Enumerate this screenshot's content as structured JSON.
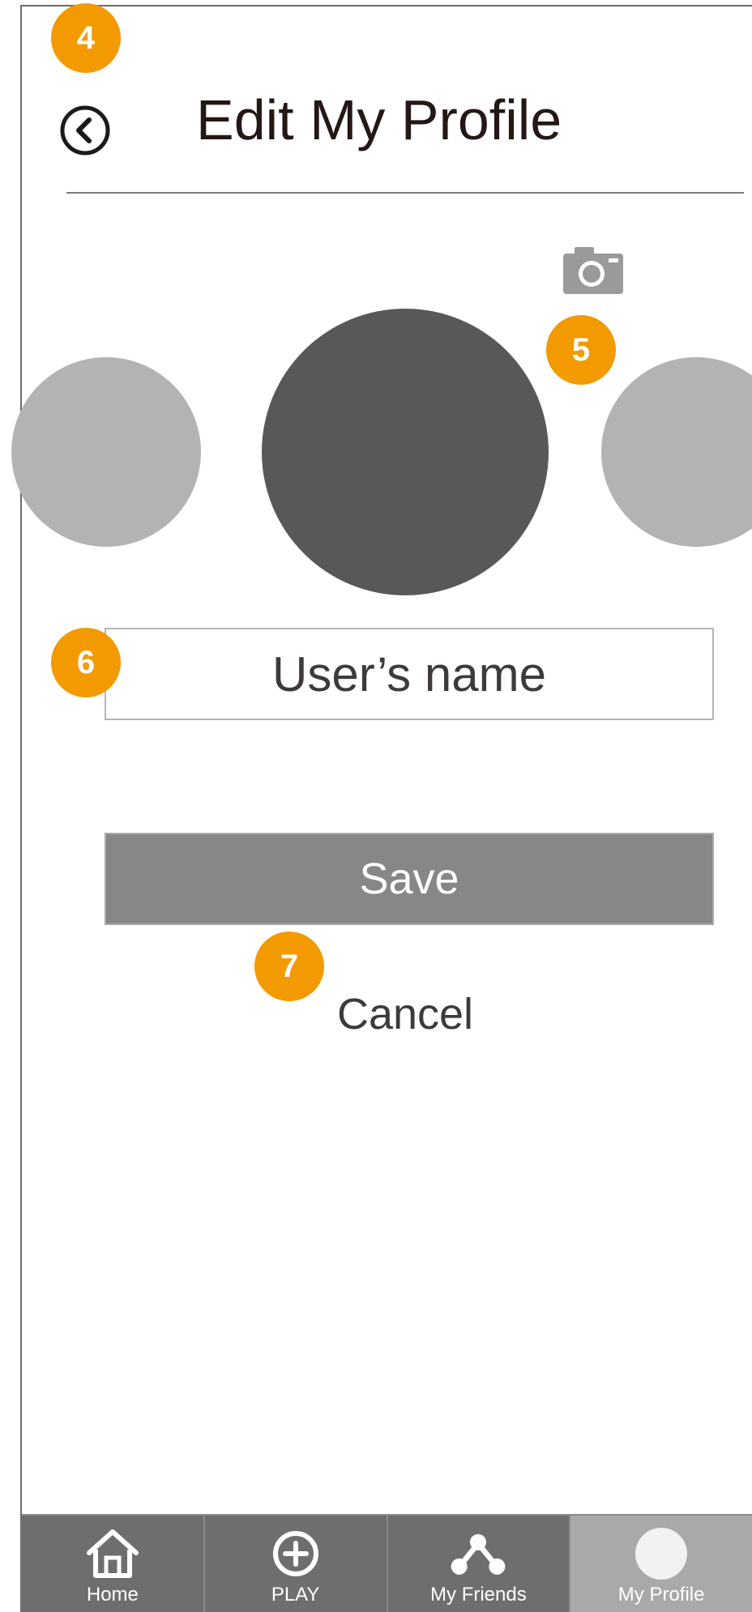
{
  "header": {
    "title": "Edit My Profile",
    "back_icon": "chevron-left-circle-icon"
  },
  "annotations": {
    "back": "4",
    "camera": "5",
    "name": "6",
    "cancel": "7"
  },
  "avatar_picker": {
    "camera_icon": "camera-icon"
  },
  "form": {
    "name_placeholder": "User’s name",
    "save_label": "Save",
    "cancel_label": "Cancel"
  },
  "tabbar": {
    "items": [
      {
        "label": "Home",
        "icon": "home-icon"
      },
      {
        "label": "PLAY",
        "icon": "plus-circle-icon"
      },
      {
        "label": "My Friends",
        "icon": "network-icon"
      },
      {
        "label": "My Profile",
        "icon": "avatar-circle-icon",
        "active": true
      }
    ]
  },
  "colors": {
    "badge": "#f29a00",
    "avatar_main": "#58585a",
    "avatar_side": "#b3b3b3",
    "save_button": "#878787",
    "tab_bg": "#6e6e6e",
    "tab_active_bg": "#a9a9a9"
  }
}
